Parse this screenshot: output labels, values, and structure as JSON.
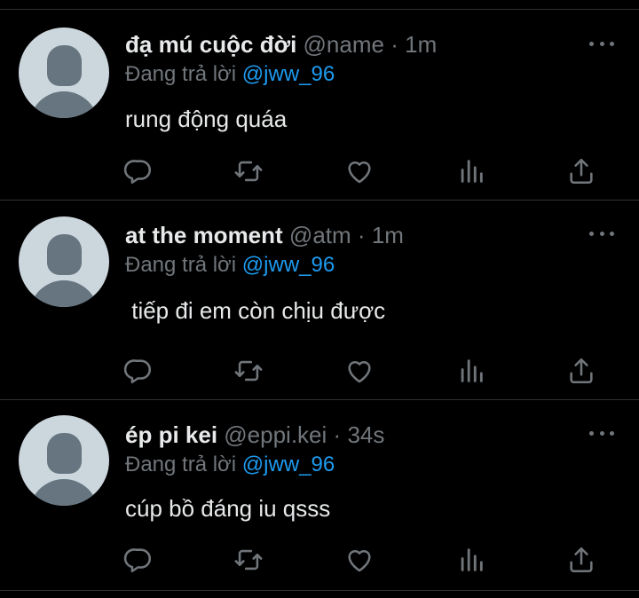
{
  "replies": [
    {
      "display_name": "đạ mú cuộc đời",
      "handle": "@name",
      "separator": "·",
      "time": "1m",
      "replying_prefix": "Đang trả lời",
      "replying_to": "@jww_96",
      "text": "rung động quáa"
    },
    {
      "display_name": "at the moment",
      "handle": "@atm",
      "separator": "·",
      "time": "1m",
      "replying_prefix": "Đang trả lời",
      "replying_to": "@jww_96",
      "text": " tiếp đi em còn chịu được"
    },
    {
      "display_name": "ép pi kei",
      "handle": "@eppi.kei",
      "separator": "·",
      "time": "34s",
      "replying_prefix": "Đang trả lời",
      "replying_to": "@jww_96",
      "text": "cúp bồ đáng iu qsss"
    }
  ],
  "icons": {
    "reply": "reply-icon",
    "retweet": "retweet-icon",
    "like": "like-icon",
    "views": "views-icon",
    "share": "share-icon",
    "more": "more-icon",
    "avatar": "default-avatar-icon"
  },
  "colors": {
    "background": "#000000",
    "text": "#e7e9ea",
    "muted": "#71767b",
    "mention": "#1d9bf0",
    "divider": "#2f3336",
    "avatar_bg": "#ccd6dd",
    "avatar_fg": "#66757f"
  }
}
